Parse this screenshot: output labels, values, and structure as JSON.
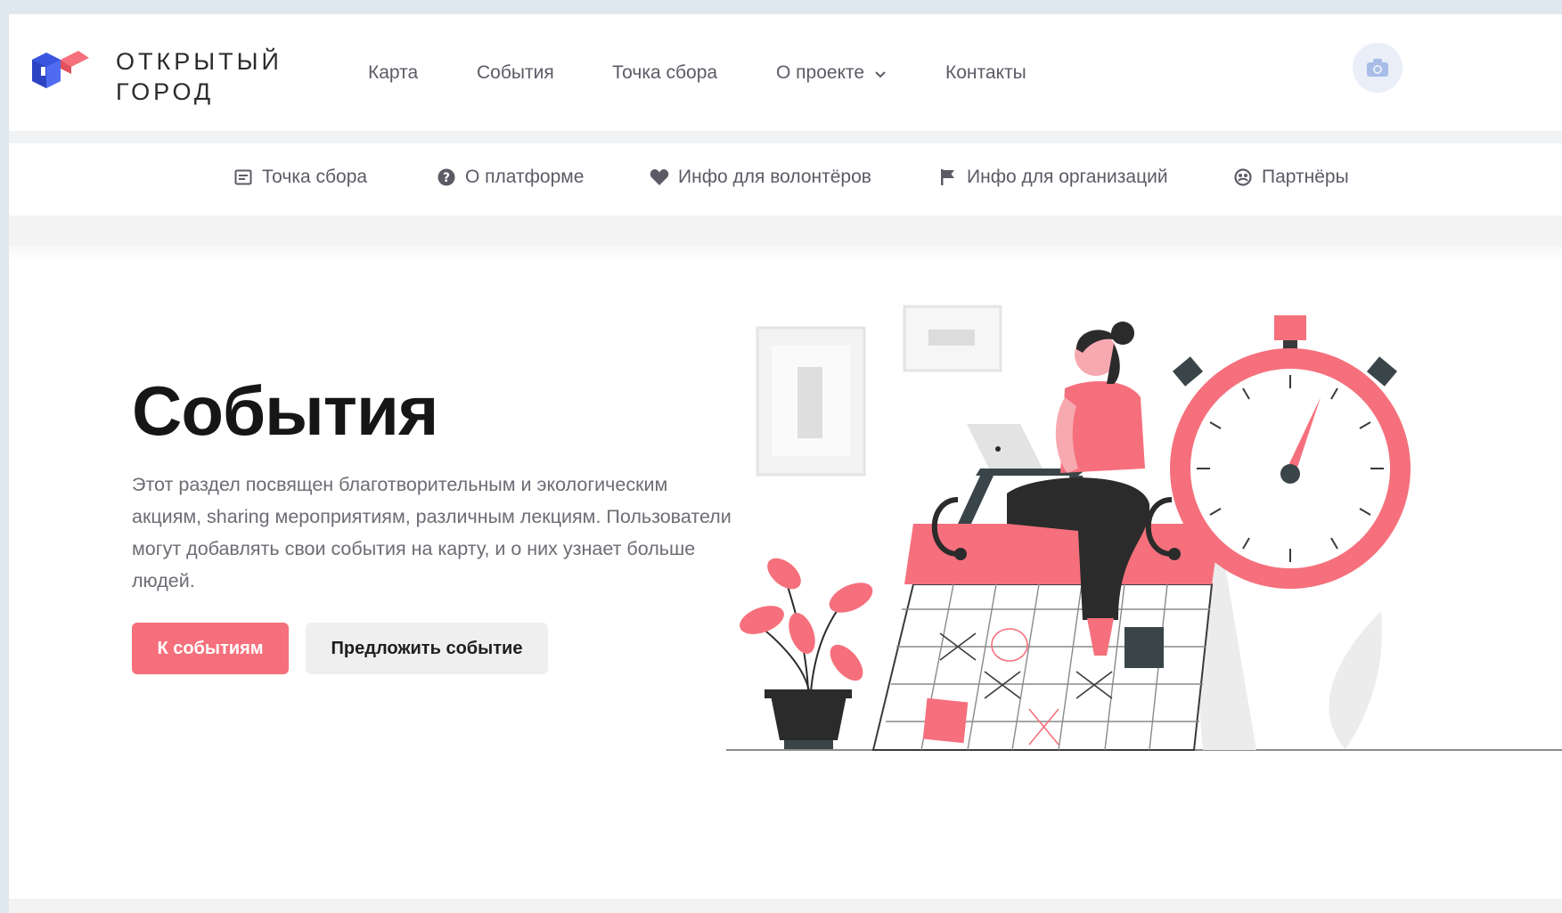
{
  "brand": {
    "line1": "ОТКРЫТЫЙ",
    "line2": "ГОРОД"
  },
  "topnav": {
    "items": [
      {
        "label": "Карта"
      },
      {
        "label": "События"
      },
      {
        "label": "Точка сбора"
      },
      {
        "label": "О проекте"
      },
      {
        "label": "Контакты"
      }
    ]
  },
  "subnav": {
    "items": [
      {
        "label": "Точка сбора",
        "icon": "document-icon"
      },
      {
        "label": "О платформе",
        "icon": "question-icon"
      },
      {
        "label": "Инфо для волонтёров",
        "icon": "heart-icon"
      },
      {
        "label": "Инфо для организаций",
        "icon": "flag-icon"
      },
      {
        "label": "Партнёры",
        "icon": "partners-icon"
      }
    ]
  },
  "hero": {
    "title": "События",
    "description": "Этот раздел посвящен благотворительным и экологическим акциям, sharing мероприятиям, различным лекциям. Пользователи могут добавлять свои события на карту, и о них узнает больше людей.",
    "primary_button": "К событиям",
    "secondary_button": "Предложить событие"
  },
  "colors": {
    "accent": "#f5707c",
    "text": "#2b2b2b",
    "muted": "#6c6c74",
    "logo_blue": "#3a56e0",
    "logo_pink": "#f5707c"
  }
}
